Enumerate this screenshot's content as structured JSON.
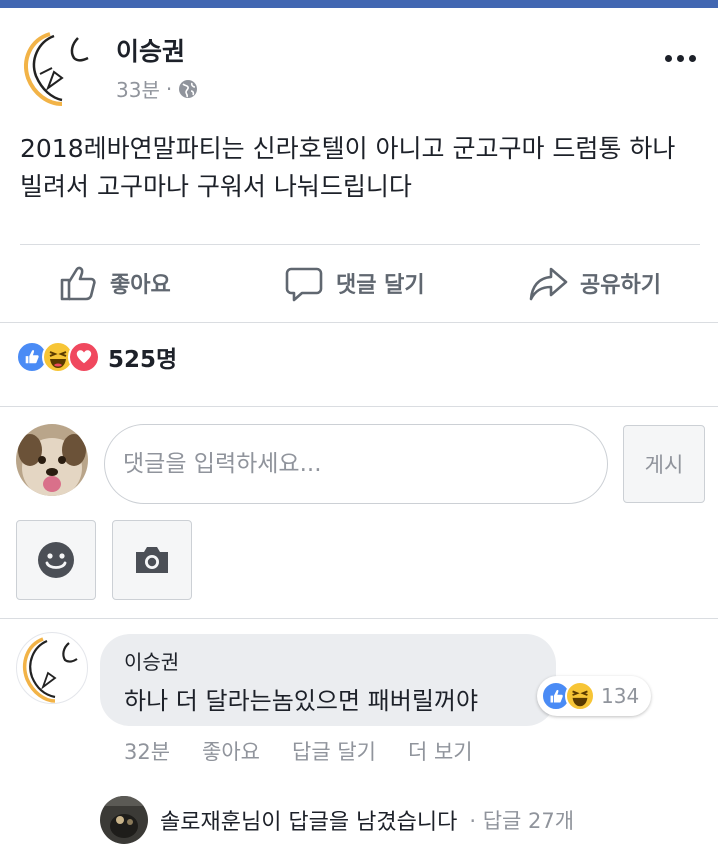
{
  "colors": {
    "brand": "#4267b2",
    "like": "#4a8bf5",
    "haha": "#f7c536",
    "love": "#f0485e",
    "muted": "#90949c"
  },
  "post": {
    "author": "이승권",
    "time": "33분",
    "separator": "·",
    "privacy_icon": "globe-icon",
    "text": "2018레바연말파티는 신라호텔이 아니고 군고구마 드럼통 하나 빌려서 고구마나 구워서 나눠드립니다"
  },
  "actions": {
    "like_label": "좋아요",
    "comment_label": "댓글 달기",
    "share_label": "공유하기"
  },
  "reactions": {
    "icons": [
      "like-icon",
      "haha-icon",
      "love-icon"
    ],
    "count": "525명"
  },
  "composer": {
    "placeholder": "댓글을 입력하세요...",
    "post_button": "게시",
    "emoji_icon": "smiley-icon",
    "camera_icon": "camera-icon"
  },
  "comment": {
    "author": "이승권",
    "text": "하나 더 달라는놈있으면 패버릴꺼야",
    "reaction_count": "134",
    "time": "32분",
    "like": "좋아요",
    "reply": "답글 달기",
    "more": "더 보기"
  },
  "reply_summary": {
    "text": "솔로재훈님이 답글을 남겼습니다",
    "count": "· 답글 27개"
  }
}
